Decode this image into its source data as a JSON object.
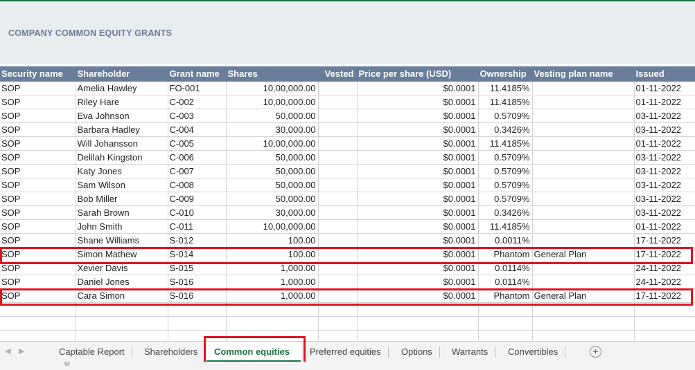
{
  "title": "COMPANY COMMON EQUITY GRANTS",
  "columns": [
    "Security name",
    "Shareholder",
    "Grant name",
    "Shares",
    "Vested",
    "Price per share (USD)",
    "Ownership",
    "Vesting plan name",
    "Issued"
  ],
  "rows": [
    {
      "security": "SOP",
      "shareholder": "Amelia Hawley",
      "grant": "FO-001",
      "shares": "10,00,000.00",
      "vested": "",
      "price": "$0.0001",
      "ownership": "11.4185%",
      "plan": "",
      "issued": "01-11-2022"
    },
    {
      "security": "SOP",
      "shareholder": "Riley Hare",
      "grant": "C-002",
      "shares": "10,00,000.00",
      "vested": "",
      "price": "$0.0001",
      "ownership": "11.4185%",
      "plan": "",
      "issued": "01-11-2022"
    },
    {
      "security": "SOP",
      "shareholder": "Eva Johnson",
      "grant": "C-003",
      "shares": "50,000.00",
      "vested": "",
      "price": "$0.0001",
      "ownership": "0.5709%",
      "plan": "",
      "issued": "03-11-2022"
    },
    {
      "security": "SOP",
      "shareholder": "Barbara Hadley",
      "grant": "C-004",
      "shares": "30,000.00",
      "vested": "",
      "price": "$0.0001",
      "ownership": "0.3426%",
      "plan": "",
      "issued": "03-11-2022"
    },
    {
      "security": "SOP",
      "shareholder": "Will Johansson",
      "grant": "C-005",
      "shares": "10,00,000.00",
      "vested": "",
      "price": "$0.0001",
      "ownership": "11.4185%",
      "plan": "",
      "issued": "01-11-2022"
    },
    {
      "security": "SOP",
      "shareholder": "Delilah Kingston",
      "grant": "C-006",
      "shares": "50,000.00",
      "vested": "",
      "price": "$0.0001",
      "ownership": "0.5709%",
      "plan": "",
      "issued": "03-11-2022"
    },
    {
      "security": "SOP",
      "shareholder": "Katy Jones",
      "grant": "C-007",
      "shares": "50,000.00",
      "vested": "",
      "price": "$0.0001",
      "ownership": "0.5709%",
      "plan": "",
      "issued": "03-11-2022"
    },
    {
      "security": "SOP",
      "shareholder": "Sam Wilson",
      "grant": "C-008",
      "shares": "50,000.00",
      "vested": "",
      "price": "$0.0001",
      "ownership": "0.5709%",
      "plan": "",
      "issued": "03-11-2022"
    },
    {
      "security": "SOP",
      "shareholder": "Bob Miller",
      "grant": "C-009",
      "shares": "50,000.00",
      "vested": "",
      "price": "$0.0001",
      "ownership": "0.5709%",
      "plan": "",
      "issued": "03-11-2022"
    },
    {
      "security": "SOP",
      "shareholder": "Sarah Brown",
      "grant": "C-010",
      "shares": "30,000.00",
      "vested": "",
      "price": "$0.0001",
      "ownership": "0.3426%",
      "plan": "",
      "issued": "03-11-2022"
    },
    {
      "security": "SOP",
      "shareholder": "John Smith",
      "grant": "C-011",
      "shares": "10,00,000.00",
      "vested": "",
      "price": "$0.0001",
      "ownership": "11.4185%",
      "plan": "",
      "issued": "01-11-2022"
    },
    {
      "security": "SOP",
      "shareholder": "Shane Williams",
      "grant": "S-012",
      "shares": "100.00",
      "vested": "",
      "price": "$0.0001",
      "ownership": "0.0011%",
      "plan": "",
      "issued": "17-11-2022"
    },
    {
      "security": "SOP",
      "shareholder": "Simon Mathew",
      "grant": "S-014",
      "shares": "100.00",
      "vested": "",
      "price": "$0.0001",
      "ownership": "Phantom",
      "plan": "General Plan",
      "issued": "17-11-2022"
    },
    {
      "security": "SOP",
      "shareholder": "Xevier Davis",
      "grant": "S-015",
      "shares": "1,000.00",
      "vested": "",
      "price": "$0.0001",
      "ownership": "0.0114%",
      "plan": "",
      "issued": "24-11-2022"
    },
    {
      "security": "SOP",
      "shareholder": "Daniel  Jones",
      "grant": "S-016",
      "shares": "1,000.00",
      "vested": "",
      "price": "$0.0001",
      "ownership": "0.0114%",
      "plan": "",
      "issued": "24-11-2022"
    },
    {
      "security": "SOP",
      "shareholder": "Cara Simon",
      "grant": "S-016",
      "shares": "1,000.00",
      "vested": "",
      "price": "$0.0001",
      "ownership": "Phantom",
      "plan": "General Plan",
      "issued": "17-11-2022"
    }
  ],
  "sheet_tabs": [
    "Captable Report",
    "Shareholders",
    "Common equities",
    "Preferred equities",
    "Options",
    "Warrants",
    "Convertibles"
  ],
  "active_tab": "Common equities",
  "highlight_color": "#e0141e",
  "accent_color": "#1e7145",
  "header_color": "#6a7d9a",
  "icons": {
    "nav_prev": "triangle-left-icon",
    "nav_next": "triangle-right-icon",
    "add_sheet": "plus-circle-icon"
  }
}
